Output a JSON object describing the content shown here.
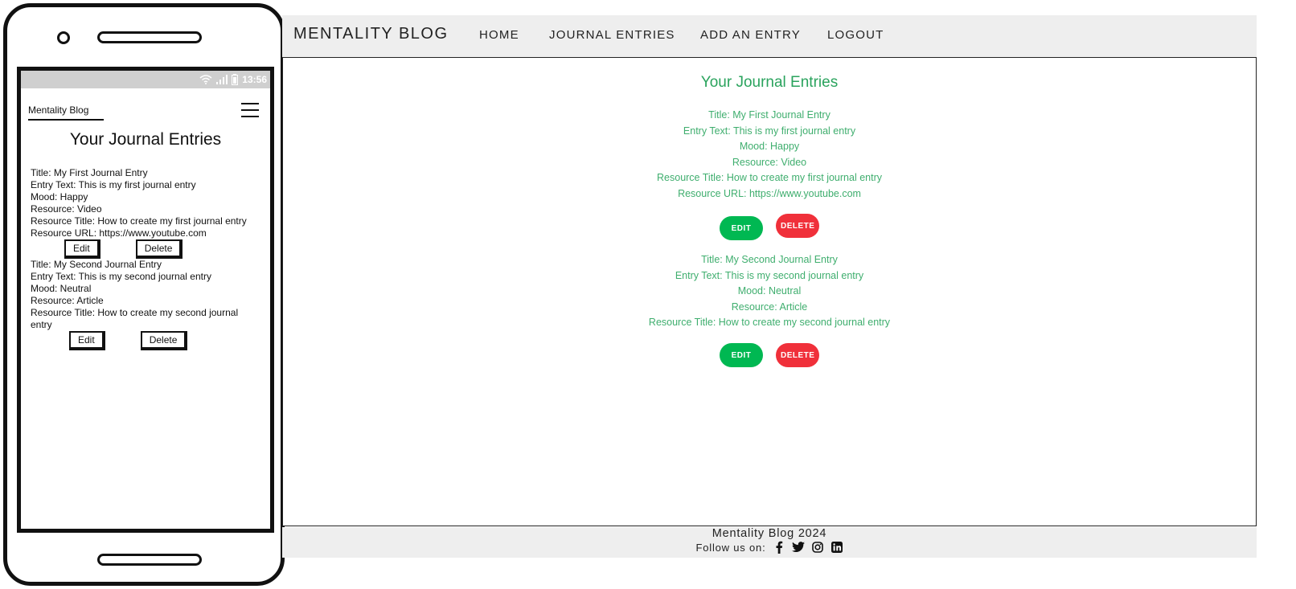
{
  "mobile": {
    "status_time": "13:56",
    "brand": "Mentality Blog",
    "heading": "Your Journal Entries",
    "entries": [
      {
        "title": "Title: My First Journal Entry",
        "text": "Entry Text: This is my first journal entry",
        "mood": "Mood: Happy",
        "resource": "Resource: Video",
        "resource_title": "Resource Title: How to create my first journal entry",
        "resource_url": "Resource URL: https://www.youtube.com",
        "edit_label": "Edit",
        "delete_label": "Delete"
      },
      {
        "title": "Title: My Second Journal Entry",
        "text": "Entry Text: This is my second journal entry",
        "mood": "Mood: Neutral",
        "resource": "Resource: Article",
        "resource_title": "Resource Title: How to create my second journal entry",
        "edit_label": "Edit",
        "delete_label": "Delete"
      }
    ]
  },
  "desktop": {
    "brand": "MENTALITY BLOG",
    "nav": [
      "HOME",
      "JOURNAL ENTRIES",
      "ADD AN ENTRY",
      "LOGOUT"
    ],
    "heading": "Your Journal Entries",
    "entries": [
      {
        "title": "Title: My First Journal Entry",
        "text": "Entry Text: This is my first journal entry",
        "mood": "Mood: Happy",
        "resource": "Resource: Video",
        "resource_title": "Resource Title: How to create my first journal entry",
        "resource_url": "Resource URL: https://www.youtube.com",
        "edit_label": "EDIT",
        "delete_label": "DELETE"
      },
      {
        "title": "Title: My Second Journal Entry",
        "text": "Entry Text: This is my second journal entry",
        "mood": "Mood: Neutral",
        "resource": "Resource: Article",
        "resource_title": "Resource Title: How to create my second journal entry",
        "edit_label": "EDIT",
        "delete_label": "DELETE"
      }
    ],
    "footer": {
      "title": "Mentality Blog 2024",
      "follow_label": "Follow us on:",
      "social_icons": [
        "facebook-icon",
        "twitter-icon",
        "instagram-icon",
        "linkedin-icon"
      ]
    }
  },
  "colors": {
    "heading_green": "#2aa35d",
    "text_green": "#3fae6e",
    "edit_button": "#00b852",
    "delete_button": "#f0303a",
    "bar_gray": "#eeeeee"
  }
}
